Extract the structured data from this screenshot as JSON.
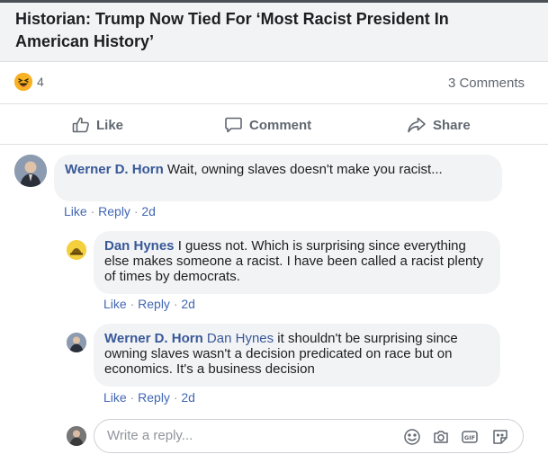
{
  "post": {
    "title": "Historian: Trump Now Tied For ‘Most Racist President In American History’",
    "reaction_count": "4",
    "comment_count": "3 Comments"
  },
  "actions": {
    "like": "Like",
    "comment": "Comment",
    "share": "Share"
  },
  "comments": [
    {
      "author": "Werner D. Horn",
      "mention": "",
      "text": "Wait, owning slaves doesn't make you racist...",
      "like": "Like",
      "reply": "Reply",
      "time": "2d"
    },
    {
      "author": "Dan Hynes",
      "mention": "",
      "text": "I guess not. Which is surprising since everything else makes someone a racist. I have been called a racist plenty of times by democrats.",
      "like": "Like",
      "reply": "Reply",
      "time": "2d"
    },
    {
      "author": "Werner D. Horn",
      "mention": "Dan Hynes",
      "text": "it shouldn't be surprising since owning slaves wasn't a decision predicated on race but on economics. It's a business decision",
      "like": "Like",
      "reply": "Reply",
      "time": "2d"
    }
  ],
  "reply_box": {
    "placeholder": "Write a reply..."
  },
  "icons": {
    "reaction": "haha-emoji-icon",
    "like": "thumbs-up-icon",
    "comment": "speech-bubble-icon",
    "share": "share-arrow-icon",
    "emoji": "smiley-icon",
    "camera": "camera-icon",
    "gif": "gif-icon",
    "sticker": "sticker-icon"
  },
  "colors": {
    "link": "#385898",
    "muted": "#606770",
    "bubble": "#f2f3f5",
    "header_bg": "#f2f3f5"
  }
}
